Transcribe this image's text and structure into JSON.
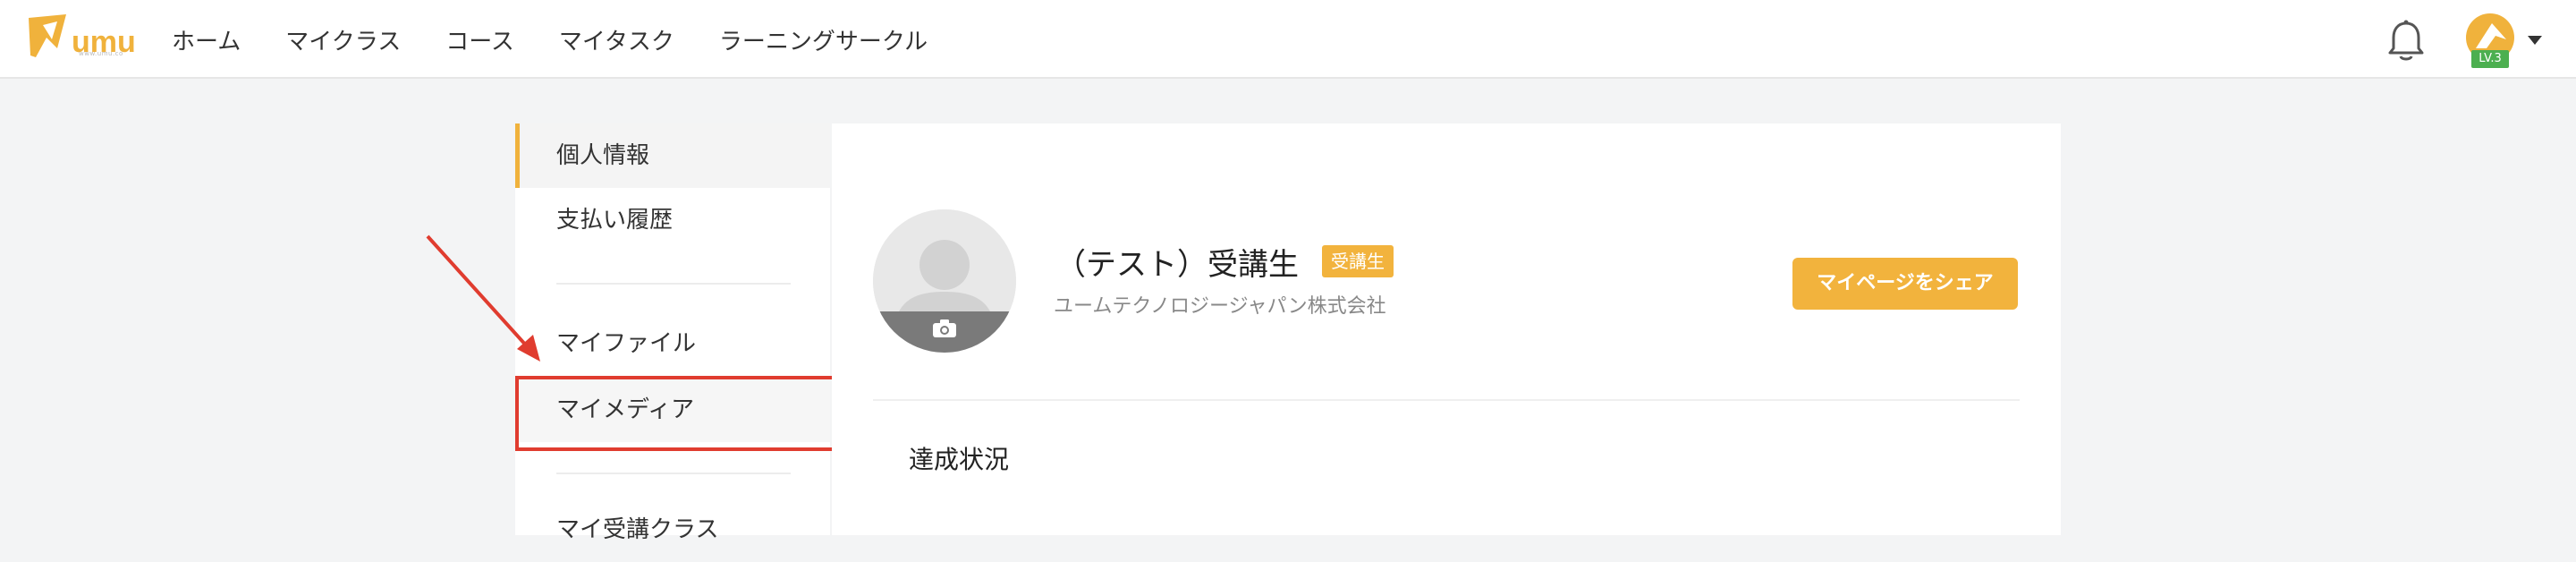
{
  "header": {
    "logo_text": "umu",
    "logo_subtext": "www.umu.co",
    "nav": [
      {
        "label": "ホーム"
      },
      {
        "label": "マイクラス"
      },
      {
        "label": "コース"
      },
      {
        "label": "マイタスク"
      },
      {
        "label": "ラーニングサークル"
      }
    ],
    "level_badge": "LV.3",
    "icons": [
      "bell-icon",
      "user-avatar",
      "chevron-down-icon"
    ]
  },
  "sidebar": {
    "items": [
      {
        "label": "個人情報",
        "active": true
      },
      {
        "label": "支払い履歴"
      },
      {
        "label": "マイファイル"
      },
      {
        "label": "マイメディア",
        "highlighted": true
      },
      {
        "label": "マイ受講クラス"
      }
    ]
  },
  "profile": {
    "name": "（テスト）受講生",
    "role_badge": "受講生",
    "company": "ユームテクノロジージャパン株式会社",
    "share_button": "マイページをシェア",
    "avatar_icon": "camera-icon"
  },
  "main": {
    "section_title": "達成状況"
  },
  "colors": {
    "accent": "#f2b33d",
    "annotation_red": "#e03c2f",
    "level_green": "#4caf50",
    "background": "#f3f4f5"
  }
}
